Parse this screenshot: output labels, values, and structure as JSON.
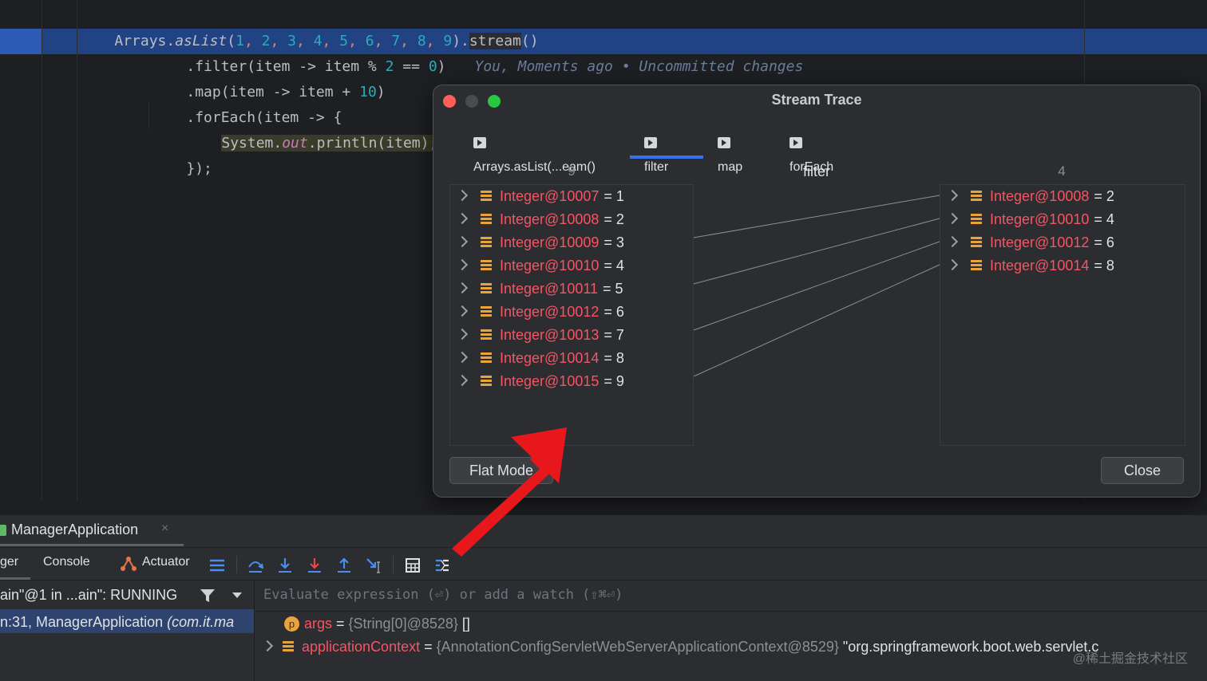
{
  "editor": {
    "line1": {
      "prefix": "Arrays.",
      "method": "asList",
      "open": "(",
      "nums": [
        "1",
        "2",
        "3",
        "4",
        "5",
        "6",
        "7",
        "8",
        "9"
      ],
      "close": ").",
      "stream": "stream",
      "end": "()"
    },
    "line2": {
      "text": ".filter(item -> item % ",
      "num": "2",
      "mid": " == ",
      "num2": "0",
      "end": ")",
      "blame": "You, Moments ago • Uncommitted changes"
    },
    "line3": {
      "text": ".map(item -> item + ",
      "num": "10",
      "end": ")"
    },
    "line4": {
      "text": ".forEach(item -> {"
    },
    "line5": {
      "pre": "System.",
      "field": "out",
      "post": ".println(item);"
    },
    "line6": {
      "text": "});"
    }
  },
  "dialog": {
    "title": "Stream Trace",
    "tabs": [
      "Arrays.asList(...eam()",
      "filter",
      "map",
      "forEach"
    ],
    "active_tab": "filter",
    "left_count": "9",
    "mid_label": "filter",
    "right_count": "4",
    "left_items": [
      {
        "name": "Integer@10007",
        "value": "= 1"
      },
      {
        "name": "Integer@10008",
        "value": "= 2"
      },
      {
        "name": "Integer@10009",
        "value": "= 3"
      },
      {
        "name": "Integer@10010",
        "value": "= 4"
      },
      {
        "name": "Integer@10011",
        "value": "= 5"
      },
      {
        "name": "Integer@10012",
        "value": "= 6"
      },
      {
        "name": "Integer@10013",
        "value": "= 7"
      },
      {
        "name": "Integer@10014",
        "value": "= 8"
      },
      {
        "name": "Integer@10015",
        "value": "= 9"
      }
    ],
    "right_items": [
      {
        "name": "Integer@10008",
        "value": "= 2"
      },
      {
        "name": "Integer@10010",
        "value": "= 4"
      },
      {
        "name": "Integer@10012",
        "value": "= 6"
      },
      {
        "name": "Integer@10014",
        "value": "= 8"
      }
    ],
    "flat_mode": "Flat Mode",
    "close": "Close"
  },
  "tool": {
    "run_tab": "ManagerApplication",
    "tabs": [
      "ger",
      "Console",
      "Actuator"
    ],
    "thread": "ain\"@1 in ...ain\": RUNNING",
    "eval_placeholder": "Evaluate expression (⏎) or add a watch (⇧⌘⏎)",
    "frame": "n:31, ManagerApplication",
    "frame_pkg": "(com.it.ma",
    "vars": [
      {
        "badge": "p",
        "name": "args",
        "eq": " = ",
        "value": "{String[0]@8528}",
        "extra": " []"
      },
      {
        "badge": "list",
        "name": "applicationContext",
        "eq": " = ",
        "value": "{AnnotationConfigServletWebServerApplicationContext@8529}",
        "extra": " \"org.springframework.boot.web.servlet.c"
      }
    ]
  },
  "watermark": "@稀土掘金技术社区",
  "colors": {
    "accent": "#3574f0",
    "highlight": "#214283",
    "arrow": "#e8171c",
    "object_name": "#f75464"
  }
}
